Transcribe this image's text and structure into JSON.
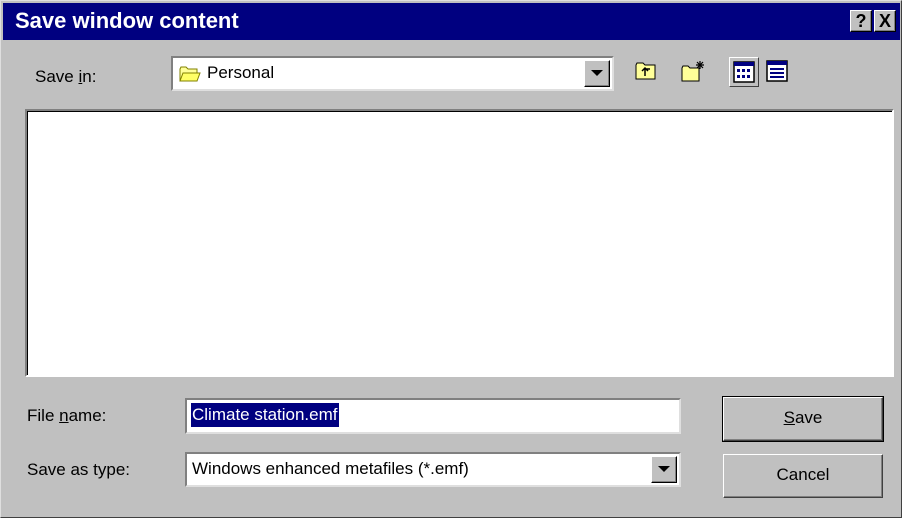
{
  "window": {
    "title": "Save window content"
  },
  "titlebar": {
    "help_label": "?",
    "close_label": "X"
  },
  "save_in": {
    "label_pre": "Save ",
    "label_key": "i",
    "label_post": "n:",
    "value": "Personal",
    "icon": "folder-icon"
  },
  "toolbar": {
    "up_one_level": "folder-up-icon",
    "create_new_folder": "new-folder-icon",
    "list_view": "list-view-icon",
    "details_view": "details-view-icon"
  },
  "file_name": {
    "label_pre": "File ",
    "label_key": "n",
    "label_post": "ame:",
    "value": "Climate station.emf"
  },
  "save_as_type": {
    "label": "Save as type:",
    "value": "Windows enhanced metafiles (*.emf)"
  },
  "buttons": {
    "save_key": "S",
    "save_rest": "ave",
    "cancel": "Cancel"
  }
}
